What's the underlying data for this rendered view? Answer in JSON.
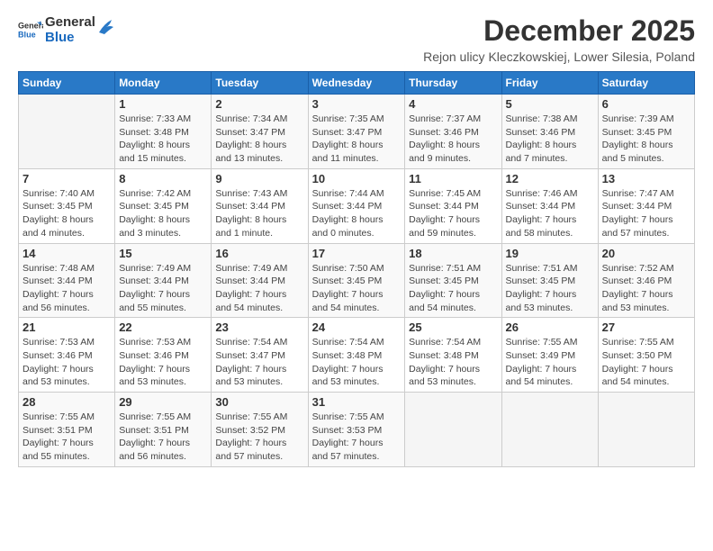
{
  "logo": {
    "line1": "General",
    "line2": "Blue"
  },
  "title": "December 2025",
  "subtitle": "Rejon ulicy Kleczkowskiej, Lower Silesia, Poland",
  "days_of_week": [
    "Sunday",
    "Monday",
    "Tuesday",
    "Wednesday",
    "Thursday",
    "Friday",
    "Saturday"
  ],
  "weeks": [
    [
      {
        "day": "",
        "detail": ""
      },
      {
        "day": "1",
        "detail": "Sunrise: 7:33 AM\nSunset: 3:48 PM\nDaylight: 8 hours\nand 15 minutes."
      },
      {
        "day": "2",
        "detail": "Sunrise: 7:34 AM\nSunset: 3:47 PM\nDaylight: 8 hours\nand 13 minutes."
      },
      {
        "day": "3",
        "detail": "Sunrise: 7:35 AM\nSunset: 3:47 PM\nDaylight: 8 hours\nand 11 minutes."
      },
      {
        "day": "4",
        "detail": "Sunrise: 7:37 AM\nSunset: 3:46 PM\nDaylight: 8 hours\nand 9 minutes."
      },
      {
        "day": "5",
        "detail": "Sunrise: 7:38 AM\nSunset: 3:46 PM\nDaylight: 8 hours\nand 7 minutes."
      },
      {
        "day": "6",
        "detail": "Sunrise: 7:39 AM\nSunset: 3:45 PM\nDaylight: 8 hours\nand 5 minutes."
      }
    ],
    [
      {
        "day": "7",
        "detail": "Sunrise: 7:40 AM\nSunset: 3:45 PM\nDaylight: 8 hours\nand 4 minutes."
      },
      {
        "day": "8",
        "detail": "Sunrise: 7:42 AM\nSunset: 3:45 PM\nDaylight: 8 hours\nand 3 minutes."
      },
      {
        "day": "9",
        "detail": "Sunrise: 7:43 AM\nSunset: 3:44 PM\nDaylight: 8 hours\nand 1 minute."
      },
      {
        "day": "10",
        "detail": "Sunrise: 7:44 AM\nSunset: 3:44 PM\nDaylight: 8 hours\nand 0 minutes."
      },
      {
        "day": "11",
        "detail": "Sunrise: 7:45 AM\nSunset: 3:44 PM\nDaylight: 7 hours\nand 59 minutes."
      },
      {
        "day": "12",
        "detail": "Sunrise: 7:46 AM\nSunset: 3:44 PM\nDaylight: 7 hours\nand 58 minutes."
      },
      {
        "day": "13",
        "detail": "Sunrise: 7:47 AM\nSunset: 3:44 PM\nDaylight: 7 hours\nand 57 minutes."
      }
    ],
    [
      {
        "day": "14",
        "detail": "Sunrise: 7:48 AM\nSunset: 3:44 PM\nDaylight: 7 hours\nand 56 minutes."
      },
      {
        "day": "15",
        "detail": "Sunrise: 7:49 AM\nSunset: 3:44 PM\nDaylight: 7 hours\nand 55 minutes."
      },
      {
        "day": "16",
        "detail": "Sunrise: 7:49 AM\nSunset: 3:44 PM\nDaylight: 7 hours\nand 54 minutes."
      },
      {
        "day": "17",
        "detail": "Sunrise: 7:50 AM\nSunset: 3:45 PM\nDaylight: 7 hours\nand 54 minutes."
      },
      {
        "day": "18",
        "detail": "Sunrise: 7:51 AM\nSunset: 3:45 PM\nDaylight: 7 hours\nand 54 minutes."
      },
      {
        "day": "19",
        "detail": "Sunrise: 7:51 AM\nSunset: 3:45 PM\nDaylight: 7 hours\nand 53 minutes."
      },
      {
        "day": "20",
        "detail": "Sunrise: 7:52 AM\nSunset: 3:46 PM\nDaylight: 7 hours\nand 53 minutes."
      }
    ],
    [
      {
        "day": "21",
        "detail": "Sunrise: 7:53 AM\nSunset: 3:46 PM\nDaylight: 7 hours\nand 53 minutes."
      },
      {
        "day": "22",
        "detail": "Sunrise: 7:53 AM\nSunset: 3:46 PM\nDaylight: 7 hours\nand 53 minutes."
      },
      {
        "day": "23",
        "detail": "Sunrise: 7:54 AM\nSunset: 3:47 PM\nDaylight: 7 hours\nand 53 minutes."
      },
      {
        "day": "24",
        "detail": "Sunrise: 7:54 AM\nSunset: 3:48 PM\nDaylight: 7 hours\nand 53 minutes."
      },
      {
        "day": "25",
        "detail": "Sunrise: 7:54 AM\nSunset: 3:48 PM\nDaylight: 7 hours\nand 53 minutes."
      },
      {
        "day": "26",
        "detail": "Sunrise: 7:55 AM\nSunset: 3:49 PM\nDaylight: 7 hours\nand 54 minutes."
      },
      {
        "day": "27",
        "detail": "Sunrise: 7:55 AM\nSunset: 3:50 PM\nDaylight: 7 hours\nand 54 minutes."
      }
    ],
    [
      {
        "day": "28",
        "detail": "Sunrise: 7:55 AM\nSunset: 3:51 PM\nDaylight: 7 hours\nand 55 minutes."
      },
      {
        "day": "29",
        "detail": "Sunrise: 7:55 AM\nSunset: 3:51 PM\nDaylight: 7 hours\nand 56 minutes."
      },
      {
        "day": "30",
        "detail": "Sunrise: 7:55 AM\nSunset: 3:52 PM\nDaylight: 7 hours\nand 57 minutes."
      },
      {
        "day": "31",
        "detail": "Sunrise: 7:55 AM\nSunset: 3:53 PM\nDaylight: 7 hours\nand 57 minutes."
      },
      {
        "day": "",
        "detail": ""
      },
      {
        "day": "",
        "detail": ""
      },
      {
        "day": "",
        "detail": ""
      }
    ]
  ]
}
